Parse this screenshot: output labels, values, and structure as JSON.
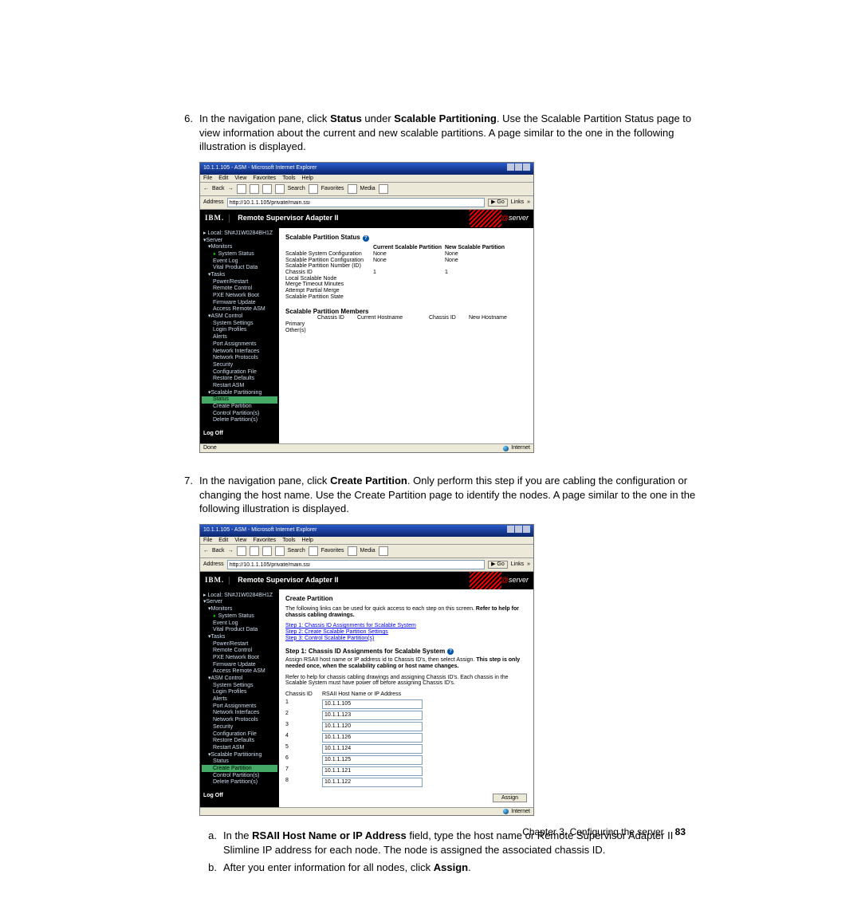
{
  "steps": {
    "s6": {
      "num": "6.",
      "t1": "In the navigation pane, click ",
      "b1": "Status",
      "t2": " under ",
      "b2": "Scalable Partitioning",
      "t3": ". Use the Scalable Partition Status page to view information about the current and new scalable partitions. A page similar to the one in the following illustration is displayed."
    },
    "s7": {
      "num": "7.",
      "t1": "In the navigation pane, click ",
      "b1": "Create Partition",
      "t2": ". Only perform this step if you are cabling the configuration or changing the host name. Use the Create Partition page to identify the nodes. A page similar to the one in the following illustration is displayed."
    },
    "a": {
      "lab": "a.",
      "t1": "In the ",
      "b1": "RSAII Host Name or IP Address",
      "t2": " field, type the host name or Remote Supervisor Adapter II Slimline IP address for each node. The node is assigned the associated chassis ID."
    },
    "b": {
      "lab": "b.",
      "t1": "After you enter information for all nodes, click ",
      "b1": "Assign",
      "t2": "."
    }
  },
  "footer": {
    "chapter": "Chapter 3. Configuring the server",
    "page": "83"
  },
  "shot_common": {
    "title": "10.1.1.105 - ASM - Microsoft Internet Explorer",
    "menus": {
      "file": "File",
      "edit": "Edit",
      "view": "View",
      "fav": "Favorites",
      "tools": "Tools",
      "help": "Help"
    },
    "addr_label": "Address",
    "addr_url": "http://10.1.1.105/private/main.ssi",
    "go": "Go",
    "links": "Links",
    "back": "Back",
    "search": "Search",
    "favorites": "Favorites",
    "media": "Media",
    "banner_logo": "IBM.",
    "banner_title": "Remote Supervisor Adapter II",
    "eserver": "server",
    "status_done": "Done",
    "status_net": "Internet",
    "help": "?"
  },
  "nav": {
    "local": "Local: SN#J1W0284BH1Z",
    "server": "Server",
    "monitors": "Monitors",
    "system_status": "System Status",
    "event_log": "Event Log",
    "vpd": "Vital Product Data",
    "tasks": "Tasks",
    "power": "Power/Restart",
    "remote": "Remote Control",
    "pxe": "PXE Network Boot",
    "firmware": "Firmware Update",
    "access_asm": "Access Remote ASM",
    "asm_control": "ASM Control",
    "sys_settings": "System Settings",
    "login": "Login Profiles",
    "alerts": "Alerts",
    "port": "Port Assignments",
    "netif": "Network Interfaces",
    "netproto": "Network Protocols",
    "security": "Security",
    "config": "Configuration File",
    "restore": "Restore Defaults",
    "restart": "Restart ASM",
    "scalpart": "Scalable Partitioning",
    "status": "Status",
    "create": "Create Partition",
    "control": "Control Partition(s)",
    "delete": "Delete Partition(s)",
    "logoff": "Log Off"
  },
  "shot1": {
    "title": "Scalable Partition Status",
    "rows": {
      "h_blank": "",
      "h_cur": "Current Scalable Partition",
      "h_new": "New Scalable Partition",
      "r1": "Scalable System Configuration",
      "r2": "Scalable Partition Configuration",
      "r3": "Scalable Partition Number (ID)",
      "r4": "Chassis ID",
      "r5": "Local Scalable Node",
      "r6": "Merge Timeout Minutes",
      "r7": "Attempt Partial Merge",
      "r8": "Scalable Partition State",
      "none": "None",
      "one": "1"
    },
    "members": "Scalable Partition Members",
    "mh": {
      "blank": "",
      "cid": "Chassis ID",
      "chost": "Current Hostname",
      "cid2": "Chassis ID",
      "nhost": "New Hostname"
    },
    "mrows": {
      "primary": "Primary",
      "others": "Other(s)"
    }
  },
  "shot2": {
    "title": "Create Partition",
    "intro": "The following links can be used for quick access to each step on this screen. ",
    "intro_bold": "Refer to help for chassis cabling drawings.",
    "link1": "Step 1: Chassis ID Assignments for Scalable System",
    "link2": "Step 2: Create Scalable Partition Settings",
    "link3": "Step 3: Control Scalable Partition(s)",
    "step1": "Step 1: Chassis ID Assignments for Scalable System",
    "note1a": "Assign RSAII host name or IP address id to Chassis ID's, then select Assign. ",
    "note1b": "This step is only needed once, when the scalability cabling or host name changes.",
    "note2": "Refer to help for chassis cabling drawings and assigning Chassis ID's. Each chassis in the Scalable System must have power off before assigning Chassis ID's.",
    "col_cid": "Chassis ID",
    "col_host": "RSAII Host Name or IP Address",
    "vals": [
      "10.1.1.105",
      "10.1.1.123",
      "10.1.1.120",
      "10.1.1.126",
      "10.1.1.124",
      "10.1.1.125",
      "10.1.1.121",
      "10.1.1.122"
    ],
    "ids": [
      "1",
      "2",
      "3",
      "4",
      "5",
      "6",
      "7",
      "8"
    ],
    "assign": "Assign"
  }
}
